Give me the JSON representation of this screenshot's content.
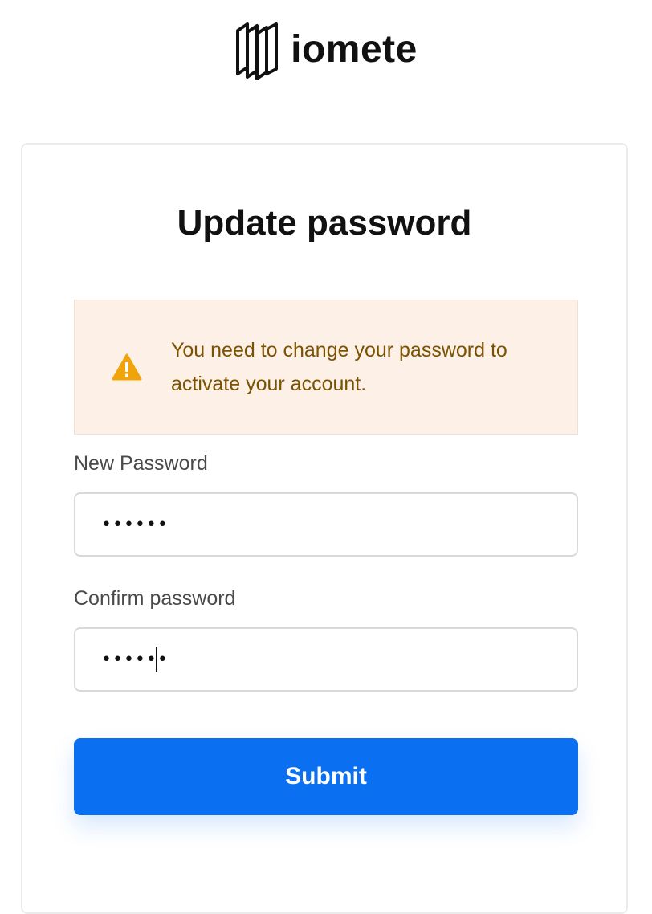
{
  "brand": {
    "name": "iomete",
    "logo_icon": "layered-panels-logo"
  },
  "card": {
    "title": "Update password"
  },
  "alert": {
    "icon": "warning-triangle-icon",
    "message": "You need to change your password to activate your account.",
    "icon_color": "#f0a30a",
    "text_color": "#7a5200",
    "background": "#fdf0e6"
  },
  "form": {
    "new_password": {
      "label": "New Password",
      "value": "••••••"
    },
    "confirm_password": {
      "label": "Confirm password",
      "value": "••••••"
    },
    "submit_label": "Submit",
    "submit_color": "#0a6ff0"
  }
}
